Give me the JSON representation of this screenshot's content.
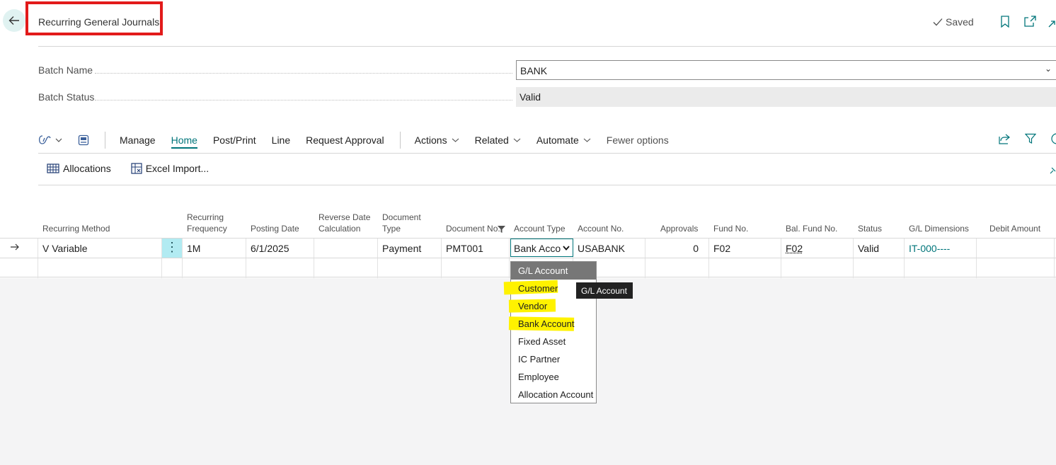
{
  "header": {
    "title": "Recurring General Journals",
    "saved_label": "Saved"
  },
  "batch": {
    "name_label": "Batch Name",
    "name_value": "BANK",
    "status_label": "Batch Status",
    "status_value": "Valid"
  },
  "toolbar": {
    "tabs": [
      "Manage",
      "Home",
      "Post/Print",
      "Line",
      "Request Approval"
    ],
    "menus": [
      "Actions",
      "Related",
      "Automate"
    ],
    "fewer_options": "Fewer options"
  },
  "actions": {
    "allocations": "Allocations",
    "excel_import": "Excel Import..."
  },
  "columns": {
    "recurring_method": "Recurring Method",
    "recurring_frequency": "Recurring Frequency",
    "posting_date": "Posting Date",
    "reverse_date_calc": "Reverse Date Calculation",
    "document_type": "Document Type",
    "document_no": "Document No.",
    "account_type": "Account Type",
    "account_no": "Account No.",
    "approvals": "Approvals",
    "fund_no": "Fund No.",
    "bal_fund_no": "Bal. Fund No.",
    "status": "Status",
    "gl_dimensions": "G/L Dimensions",
    "debit_amount": "Debit Amount"
  },
  "row": {
    "recurring_method": "V Variable",
    "recurring_frequency": "1M",
    "posting_date": "6/1/2025",
    "reverse_date_calc": "",
    "document_type": "Payment",
    "document_no": "PMT001",
    "account_type": "Bank Acco",
    "account_no": "USABANK",
    "approvals": "0",
    "fund_no": "F02",
    "bal_fund_no": "F02",
    "status": "Valid",
    "gl_dimensions": "IT-000----",
    "debit_amount": ""
  },
  "dropdown": {
    "options": [
      "G/L Account",
      "Customer",
      "Vendor",
      "Bank Account",
      "Fixed Asset",
      "IC Partner",
      "Employee",
      "Allocation Account"
    ],
    "selected": "G/L Account",
    "highlighted": [
      "Customer",
      "Vendor",
      "Bank Account"
    ],
    "tooltip": "G/L Account"
  },
  "colors": {
    "accent": "#00757a",
    "title_box": "#e21a1a",
    "highlight": "#fff200"
  }
}
